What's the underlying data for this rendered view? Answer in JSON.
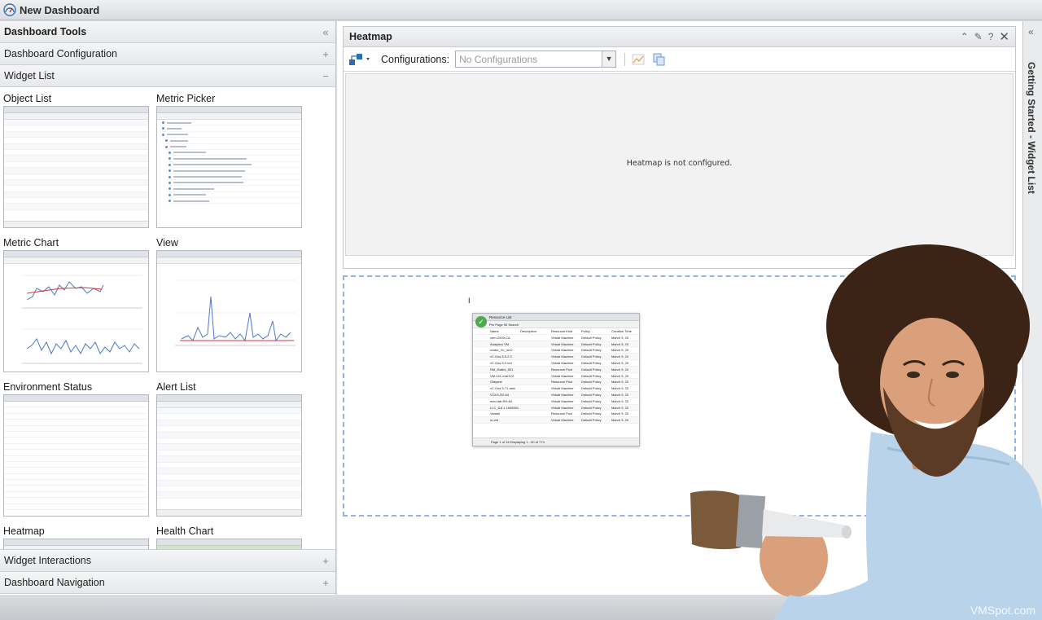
{
  "app": {
    "title": "New Dashboard"
  },
  "left": {
    "tools_title": "Dashboard Tools",
    "sections": {
      "config": "Dashboard Configuration",
      "widget_list": "Widget List",
      "interactions": "Widget Interactions",
      "navigation": "Dashboard Navigation"
    },
    "widgets": [
      "Object List",
      "Metric Picker",
      "Metric Chart",
      "View",
      "Environment Status",
      "Alert List",
      "Heatmap",
      "Health Chart"
    ]
  },
  "heatmap": {
    "title": "Heatmap",
    "config_label": "Configurations:",
    "config_value": "No Configurations",
    "empty_message": "Heatmap is not configured."
  },
  "dragged": {
    "title": "Resource List",
    "per_page": "Per Page",
    "per_page_value": "50",
    "search": "Search",
    "headers": [
      "Name",
      "Description",
      "Resource Kind",
      "Policy",
      "Creation Time"
    ],
    "rows": [
      [
        "vhm-2009-CA",
        "Virtual Machine",
        "Default Policy",
        "March 9, 20"
      ],
      [
        "Analytics VM",
        "Virtual Machine",
        "Default Policy",
        "March 9, 20"
      ],
      [
        "vclam_Vu_run2",
        "Virtual Machine",
        "Default Policy",
        "March 9, 20"
      ],
      [
        "vC.Gos 5.5.2.C",
        "Virtual Machine",
        "Default Policy",
        "March 9, 20"
      ],
      [
        "vC.Gos 5.0 net",
        "Virtual Machine",
        "Default Policy",
        "March 9, 20"
      ],
      [
        "RM_Elatini_501",
        "Resource Pool",
        "Default Policy",
        "March 9, 20"
      ],
      [
        "VM-141-eral1V2",
        "Virtual Machine",
        "Default Policy",
        "March 9, 20"
      ],
      [
        "Glayane",
        "Resource Pool",
        "Default Policy",
        "March 9, 20"
      ],
      [
        "vC.Gos 5.71-new",
        "Virtual Machine",
        "Default Policy",
        "March 9, 20"
      ],
      [
        "VCKS-R2-64",
        "Virtual Machine",
        "Default Policy",
        "March 9, 20"
      ],
      [
        "ecm-lab-RH-64",
        "Virtual Machine",
        "Default Policy",
        "March 9, 20"
      ],
      [
        "LLC_6.6.1 1645501",
        "Virtual Machine",
        "Default Policy",
        "March 9, 20"
      ],
      [
        "Vamek",
        "Resource Pool",
        "Default Policy",
        "March 9, 20"
      ],
      [
        "sr-vht",
        "Virtual Machine",
        "Default Policy",
        "March 9, 20"
      ]
    ],
    "footer": "Page 1 of 16  Displaying 1 - 50 of 774"
  },
  "right": {
    "vertical_title": "Getting Started - Widget List"
  },
  "watermark": "VMSpot.com",
  "colors": {
    "accent": "#8fb4e6",
    "ok": "#4fa94c"
  }
}
